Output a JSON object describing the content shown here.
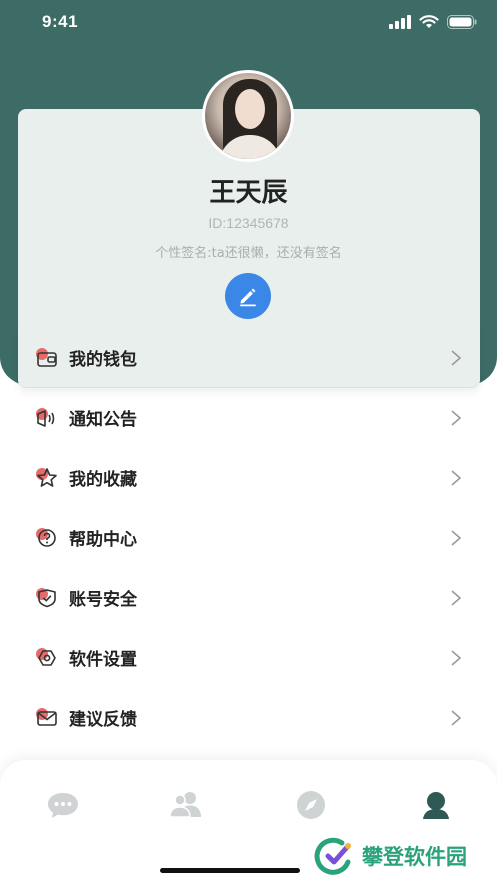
{
  "status_bar": {
    "time": "9:41",
    "icons": [
      "signal-icon",
      "wifi-icon",
      "battery-icon"
    ]
  },
  "profile": {
    "name": "王天辰",
    "id": "ID:12345678",
    "signature": "个性签名:ta还很懒，还没有签名",
    "edit_icon": "pencil-icon"
  },
  "menu": {
    "items": [
      {
        "label": "我的钱包",
        "icon": "wallet-icon"
      },
      {
        "label": "通知公告",
        "icon": "announcement-icon"
      },
      {
        "label": "我的收藏",
        "icon": "star-icon"
      },
      {
        "label": "帮助中心",
        "icon": "help-icon"
      },
      {
        "label": "账号安全",
        "icon": "shield-icon"
      },
      {
        "label": "软件设置",
        "icon": "settings-icon"
      },
      {
        "label": "建议反馈",
        "icon": "mail-icon"
      }
    ]
  },
  "tabbar": {
    "tabs": [
      {
        "icon": "chat-icon",
        "active": false
      },
      {
        "icon": "contacts-icon",
        "active": false
      },
      {
        "icon": "compass-icon",
        "active": false
      },
      {
        "icon": "profile-icon",
        "active": true
      }
    ]
  },
  "watermark": {
    "text": "攀登软件园"
  },
  "colors": {
    "header": "#3d6b66",
    "card": "#e9efed",
    "accent_blue": "#3a87e8",
    "icon_red": "#e56b6b",
    "tab_active": "#2f5955",
    "tab_inactive": "#cfd3d3",
    "watermark": "#2aa37c"
  }
}
